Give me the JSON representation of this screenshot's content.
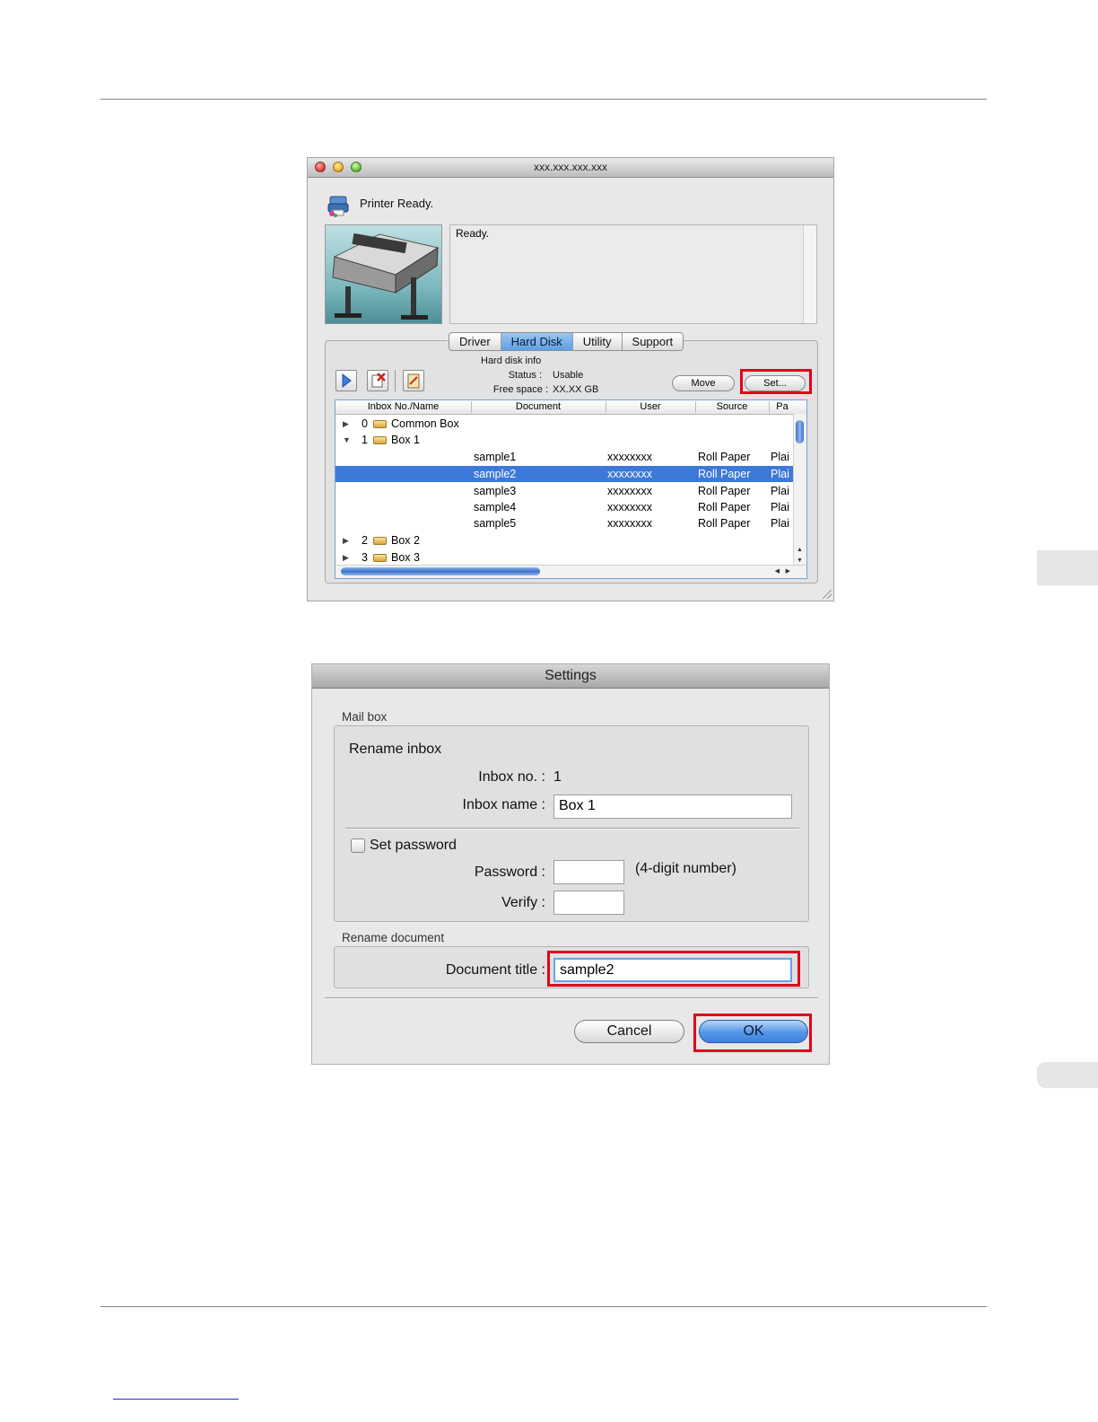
{
  "main_window": {
    "title": "xxx.xxx.xxx.xxx",
    "status_title": "Printer Ready.",
    "message": "Ready.",
    "tabs": [
      {
        "label": "Driver",
        "active": false
      },
      {
        "label": "Hard Disk",
        "active": true
      },
      {
        "label": "Utility",
        "active": false
      },
      {
        "label": "Support",
        "active": false
      }
    ],
    "hard_disk_info": {
      "heading": "Hard disk info",
      "status_label": "Status :",
      "status_value": "Usable",
      "free_space_label": "Free space :",
      "free_space_value": "XX.XX GB"
    },
    "buttons": {
      "move": "Move",
      "set": "Set..."
    },
    "table": {
      "columns": [
        "Inbox No./Name",
        "Document",
        "User",
        "Source",
        "Pa"
      ],
      "boxes": {
        "common": {
          "no": "0",
          "name": "Common Box"
        },
        "box1": {
          "no": "1",
          "name": "Box 1"
        },
        "box2": {
          "no": "2",
          "name": "Box 2"
        },
        "box3": {
          "no": "3",
          "name": "Box 3"
        }
      },
      "docs": [
        {
          "document": "sample1",
          "user": "xxxxxxxx",
          "source": "Roll Paper",
          "pa": "Plai"
        },
        {
          "document": "sample2",
          "user": "xxxxxxxx",
          "source": "Roll Paper",
          "pa": "Plai"
        },
        {
          "document": "sample3",
          "user": "xxxxxxxx",
          "source": "Roll Paper",
          "pa": "Plai"
        },
        {
          "document": "sample4",
          "user": "xxxxxxxx",
          "source": "Roll Paper",
          "pa": "Plai"
        },
        {
          "document": "sample5",
          "user": "xxxxxxxx",
          "source": "Roll Paper",
          "pa": "Plai"
        }
      ]
    }
  },
  "settings_dialog": {
    "title": "Settings",
    "mail_box_label": "Mail box",
    "rename_inbox": "Rename inbox",
    "inbox_no_label": "Inbox no. :",
    "inbox_no_value": "1",
    "inbox_name_label": "Inbox name :",
    "inbox_name_value": "Box 1",
    "set_password_label": "Set password",
    "set_password_checked": false,
    "password_label": "Password :",
    "password_hint": "(4-digit number)",
    "verify_label": "Verify :",
    "rename_document_label": "Rename document",
    "document_title_label": "Document title :",
    "document_title_value": "sample2",
    "cancel": "Cancel",
    "ok": "OK"
  },
  "colors": {
    "highlight": "#e0001b",
    "selection": "#3d79d9"
  }
}
